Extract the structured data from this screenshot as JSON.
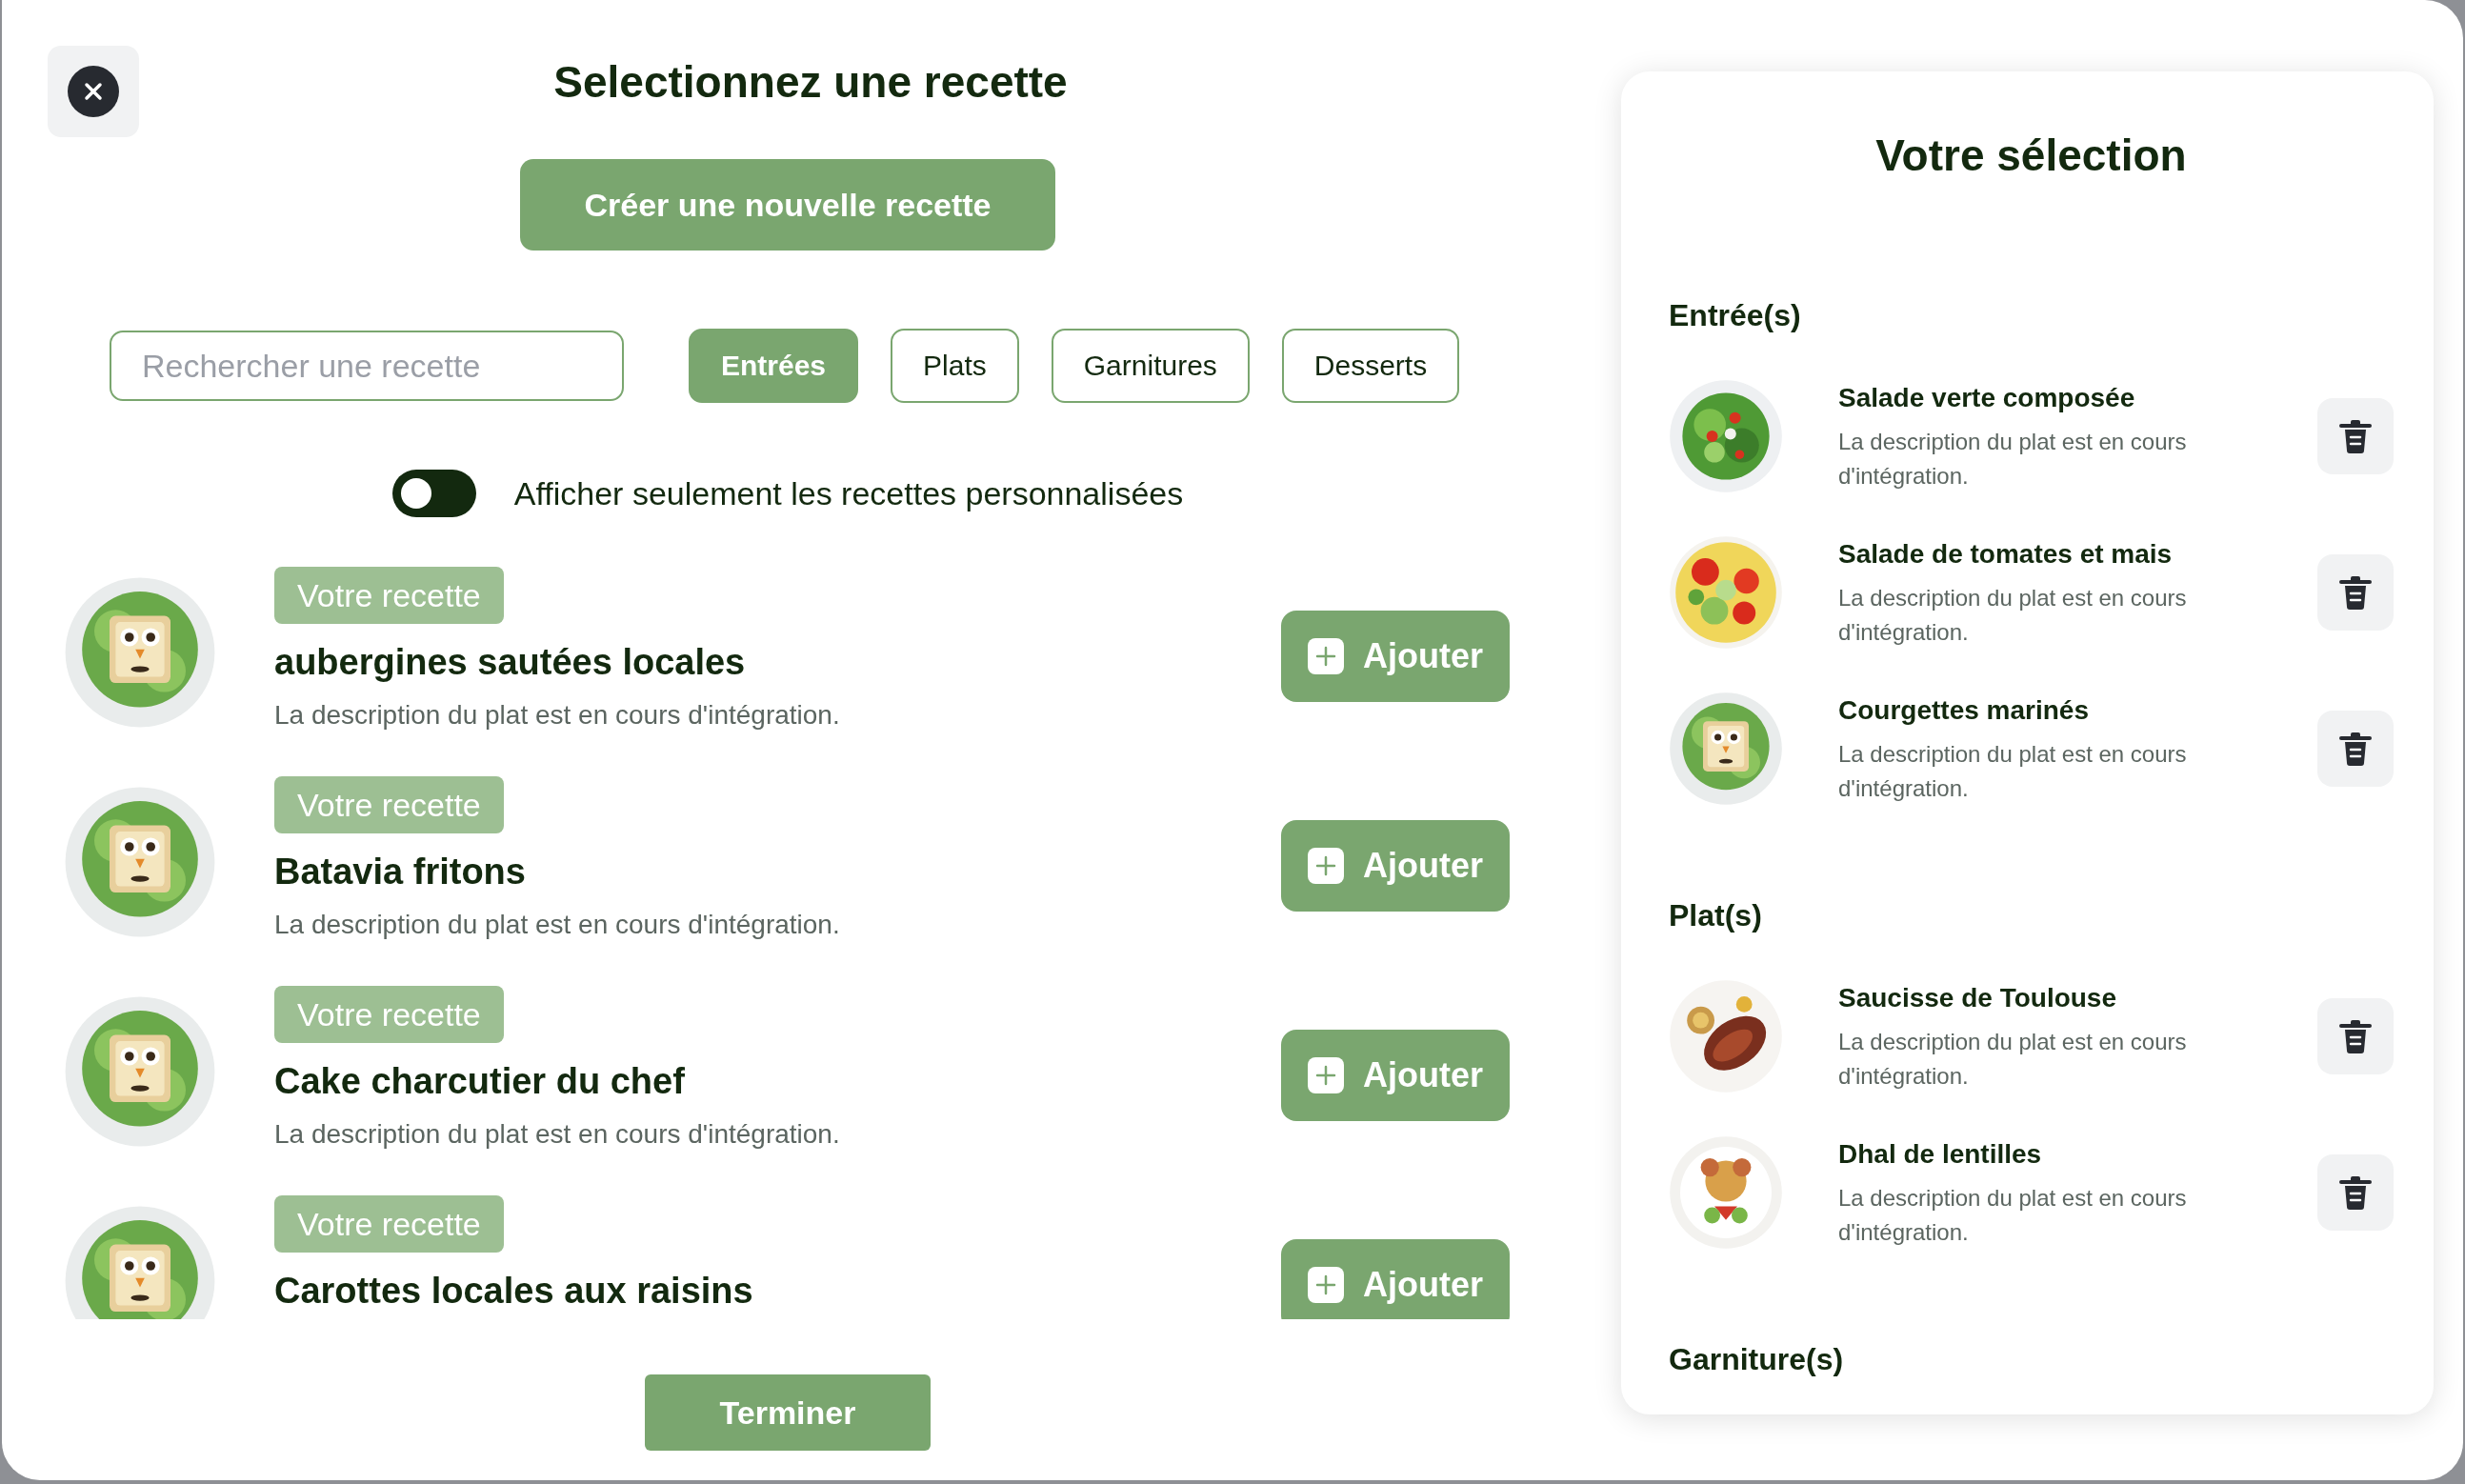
{
  "title": "Selectionnez une recette",
  "create_button": "Créer une nouvelle recette",
  "search": {
    "placeholder": "Rechercher une recette"
  },
  "filters": [
    {
      "label": "Entrées",
      "selected": true
    },
    {
      "label": "Plats",
      "selected": false
    },
    {
      "label": "Garnitures",
      "selected": false
    },
    {
      "label": "Desserts",
      "selected": false
    }
  ],
  "toggle": {
    "on": false,
    "label": "Afficher seulement les recettes personnalisées"
  },
  "recipes": [
    {
      "badge": "Votre recette",
      "name": "aubergines sautées locales",
      "description": "La description du plat est en cours d'intégration.",
      "button": "Ajouter"
    },
    {
      "badge": "Votre recette",
      "name": "Batavia fritons",
      "description": "La description du plat est en cours d'intégration.",
      "button": "Ajouter"
    },
    {
      "badge": "Votre recette",
      "name": "Cake charcutier du chef",
      "description": "La description du plat est en cours d'intégration.",
      "button": "Ajouter"
    },
    {
      "badge": "Votre recette",
      "name": "Carottes locales aux raisins",
      "button": "Ajouter"
    }
  ],
  "finish_button": "Terminer",
  "selection": {
    "title": "Votre sélection",
    "sections": [
      {
        "heading": "Entrée(s)",
        "items": [
          {
            "name": "Salade verte composée",
            "description": "La description du plat est en cours d'intégration."
          },
          {
            "name": "Salade de tomates et mais",
            "description": "La description du plat est en cours d'intégration."
          },
          {
            "name": "Courgettes marinés",
            "description": "La description du plat est en cours d'intégration."
          }
        ]
      },
      {
        "heading": "Plat(s)",
        "items": [
          {
            "name": "Saucisse de Toulouse",
            "description": "La description du plat est en cours d'intégration."
          },
          {
            "name": "Dhal de lentilles",
            "description": "La description du plat est en cours d'intégration."
          }
        ]
      },
      {
        "heading": "Garniture(s)"
      }
    ]
  }
}
